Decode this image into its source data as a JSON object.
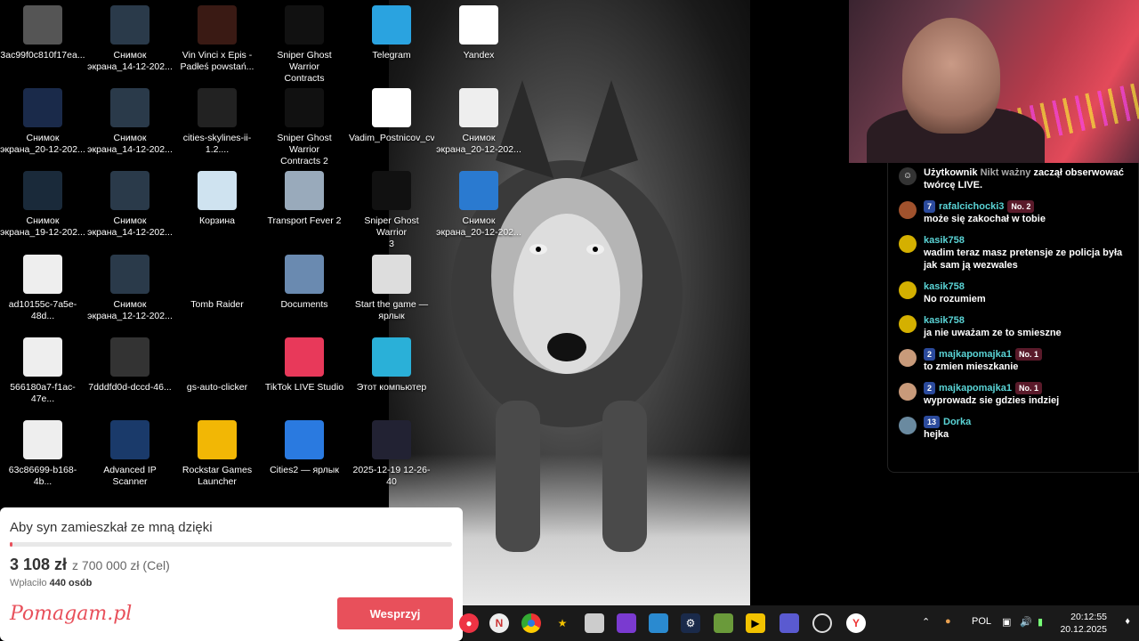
{
  "desktop_icons": [
    {
      "label": "3ac99f0c810f17ea...",
      "icon": "image-file-icon",
      "color": "#555"
    },
    {
      "label": "Снимок\nэкрана_14-12-202...",
      "icon": "screenshot-icon",
      "color": "#2a3a4a"
    },
    {
      "label": "Vin Vinci x Epis -\nPadłeś powstań...",
      "icon": "video-file-icon",
      "color": "#3a1a14"
    },
    {
      "label": "Sniper Ghost Warrior\nContracts",
      "icon": "sgw-contracts-icon",
      "color": "#111"
    },
    {
      "label": "Telegram",
      "icon": "telegram-icon",
      "color": "#2aa3e0"
    },
    {
      "label": "Yandex",
      "icon": "yandex-icon",
      "color": "#fff"
    },
    {
      "label": "Снимок\nэкрана_20-12-202...",
      "icon": "screenshot-icon",
      "color": "#1a2a4a"
    },
    {
      "label": "Снимок\nэкрана_14-12-202...",
      "icon": "screenshot-icon",
      "color": "#2a3a4a"
    },
    {
      "label": "cities-skylines-ii-1.2....",
      "icon": "rocket-icon",
      "color": "#222"
    },
    {
      "label": "Sniper Ghost Warrior\nContracts 2",
      "icon": "sgw-contracts2-icon",
      "color": "#111"
    },
    {
      "label": "Vadim_Postnicov_cv",
      "icon": "pdf-icon",
      "color": "#fff"
    },
    {
      "label": "Снимок\nэкрана_20-12-202...",
      "icon": "screenshot-icon",
      "color": "#eee"
    },
    {
      "label": "Снимок\nэкрана_19-12-202...",
      "icon": "screenshot-icon",
      "color": "#1a2a3a"
    },
    {
      "label": "Снимок\nэкрана_14-12-202...",
      "icon": "screenshot-icon",
      "color": "#2a3a4a"
    },
    {
      "label": "Корзина",
      "icon": "recycle-bin-icon",
      "color": "#cfe3f0"
    },
    {
      "label": "Transport Fever 2",
      "icon": "transport-fever-icon",
      "color": "#9ab"
    },
    {
      "label": "Sniper Ghost Warrior\n3",
      "icon": "sgw3-icon",
      "color": "#111"
    },
    {
      "label": "Снимок\nэкрана_20-12-202...",
      "icon": "screenshot-icon",
      "color": "#2a7ad0"
    },
    {
      "label": "ad10155c-7a5e-48d...",
      "icon": "image-file-icon",
      "color": "#eee"
    },
    {
      "label": "Снимок\nэкрана_12-12-202...",
      "icon": "screenshot-icon",
      "color": "#2a3a4a"
    },
    {
      "label": "Tomb Raider",
      "icon": "tomb-raider-icon",
      "color": "#000"
    },
    {
      "label": "Documents",
      "icon": "documents-folder-icon",
      "color": "#6a8ab0"
    },
    {
      "label": "Start the game —\nярлык",
      "icon": "settings-shortcut-icon",
      "color": "#ddd"
    },
    {
      "label": "566180a7-f1ac-47e...",
      "icon": "document-icon",
      "color": "#eee"
    },
    {
      "label": "7dddfd0d-dccd-46...",
      "icon": "video-file-icon",
      "color": "#333"
    },
    {
      "label": "gs-auto-clicker",
      "icon": "star-icon",
      "color": "#000"
    },
    {
      "label": "TikTok LIVE Studio",
      "icon": "tiktok-icon",
      "color": "#e8395a"
    },
    {
      "label": "Этот компьютер",
      "icon": "computer-icon",
      "color": "#2ab0d8"
    },
    {
      "label": "63c86699-b168-4b...",
      "icon": "document-icon",
      "color": "#eee"
    },
    {
      "label": "Advanced IP Scanner",
      "icon": "network-scanner-icon",
      "color": "#1a3a6a"
    },
    {
      "label": "Rockstar Games\nLauncher",
      "icon": "rockstar-icon",
      "color": "#f2b705"
    },
    {
      "label": "Cities2 — ярлык",
      "icon": "cities2-icon",
      "color": "#2a7ae0"
    },
    {
      "label": "2025-12-19 12-26-40",
      "icon": "video-file-icon",
      "color": "#223"
    }
  ],
  "chat": {
    "system_message": {
      "prefix": "Użytkownik",
      "name": "Nikt ważny",
      "suffix": "zaczął obserwować twórcę LIVE."
    },
    "messages": [
      {
        "level": "7",
        "user": "rafalcichocki3",
        "fan": "No. 2",
        "text": "może się zakochał w tobie",
        "avatar_color": "#a0522d"
      },
      {
        "level": "",
        "user": "kasik758",
        "fan": "",
        "text": "wadim teraz masz pretensje ze policja była jak sam ją wezwales",
        "avatar_color": "#d4b000"
      },
      {
        "level": "",
        "user": "kasik758",
        "fan": "",
        "text": "No rozumiem",
        "avatar_color": "#d4b000"
      },
      {
        "level": "",
        "user": "kasik758",
        "fan": "",
        "text": "ja nie uważam ze to smieszne",
        "avatar_color": "#d4b000"
      },
      {
        "level": "2",
        "user": "majkapomajka1",
        "fan": "No. 1",
        "text": "to zmien mieszkanie",
        "avatar_color": "#c89a7a"
      },
      {
        "level": "2",
        "user": "majkapomajka1",
        "fan": "No. 1",
        "text": "wyprowadz sie gdzies indziej",
        "avatar_color": "#c89a7a"
      },
      {
        "level": "13",
        "user": "Dorka",
        "fan": "",
        "text": "hejka",
        "avatar_color": "#6a8aa0"
      }
    ]
  },
  "fundraiser": {
    "title": "Aby syn zamieszkał ze mną dzięki",
    "amount": "3 108 zł",
    "goal": "z 700 000 zł (Cel)",
    "paid_prefix": "Wpłaciło",
    "paid_count": "440 osób",
    "brand": "Pomagam.pl",
    "button": "Wesprzyj",
    "progress_fraction": 0.0044,
    "accent": "#e8505b"
  },
  "taskbar": {
    "language": "POL",
    "time": "20:12:55",
    "date": "20.12.2025"
  }
}
